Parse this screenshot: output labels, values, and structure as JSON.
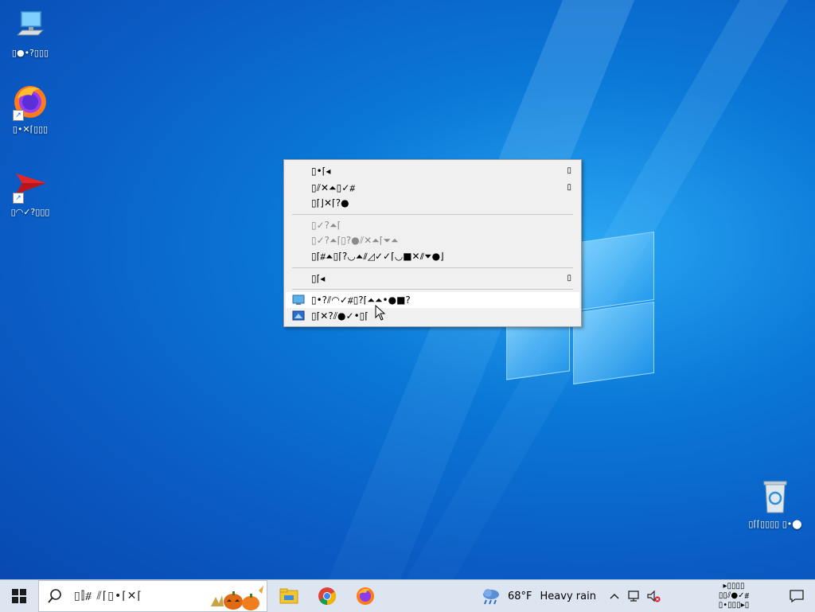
{
  "desktop": {
    "icons": [
      {
        "name": "this-pc",
        "label": "▯●•?▯▯▯"
      },
      {
        "name": "firefox",
        "label": "▯•✕⌈▯▯▯"
      },
      {
        "name": "app-shortcut",
        "label": "▯◠✓?▯▯▯"
      },
      {
        "name": "recycle-bin",
        "label": "▯⌈⌈▯▯▯▯ ▯•⬤"
      }
    ]
  },
  "context_menu": {
    "items": [
      {
        "label": "▯•⌈◂",
        "arrow": "▯",
        "disabled": false
      },
      {
        "label": "▯⫽✕⏶▯✓⧥",
        "arrow": "▯",
        "disabled": false
      },
      {
        "label": "▯⌈⌋✕⌈?●",
        "arrow": "",
        "disabled": false
      },
      {
        "label": "▯✓?⏶⌈",
        "arrow": "",
        "disabled": true
      },
      {
        "label": "▯✓?⏶⌈▯?●⫽✕⏶⌈⏷⏶",
        "arrow": "",
        "disabled": true
      },
      {
        "label": "▯⌈⧥⏶▯⌈?◡⏶⫽◿✓✓⌈◡■✕⫽⏷●⌋",
        "arrow": "",
        "disabled": false
      },
      {
        "label": "▯⌈◂",
        "arrow": "▯",
        "disabled": false
      },
      {
        "label": "▯•?⫽◠✓⧥▯?⌈⏶⏶•●■?",
        "arrow": "",
        "disabled": false,
        "icon": "display-settings-icon"
      },
      {
        "label": "▯⌈✕?⫽●✓•▯⌈",
        "arrow": "",
        "disabled": false,
        "icon": "personalize-icon"
      }
    ]
  },
  "taskbar": {
    "search_text": "▯⫿⧥ ⫽⌈▯•⌈✕⌈",
    "weather_temp": "68°F",
    "weather_text": "Heavy rain",
    "clock_line1": "▸▯▯▯▯",
    "clock_line2": "▯▯⫽●✓⧥",
    "clock_line3": "▯•▯▯▯▸▯",
    "clock_line4": "▯•▯▯▯—▭▯"
  },
  "colors": {
    "menu_bg": "#f0f0f0",
    "taskbar_bg": "#dde6f0",
    "desktop_blue": "#0a78d7"
  }
}
